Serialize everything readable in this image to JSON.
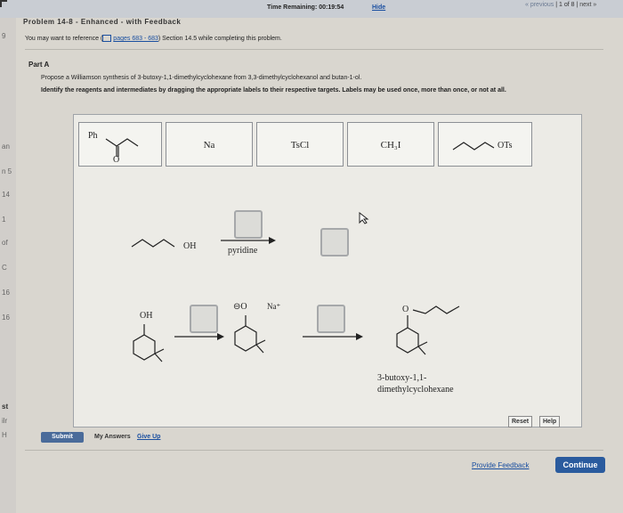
{
  "header": {
    "timer": "Time Remaining:  00:19:54",
    "hide": "Hide",
    "previous": "« previous",
    "page": "1 of 8",
    "next": "next »"
  },
  "problem": {
    "title": "Problem 14-8 - Enhanced - with Feedback",
    "reference_prefix": "You may want to reference (",
    "reference_link": "pages 683 - 683",
    "reference_suffix": ") Section 14.5 while completing this problem."
  },
  "part": {
    "label": "Part A",
    "prompt": "Propose a Williamson synthesis of 3-butoxy-1,1-dimethylcyclohexane from 3,3-dimethylcyclohexanol and butan-1-ol.",
    "instructions": "Identify the reagents and intermediates by dragging the appropriate labels to their respective targets. Labels may be used once, more than once, or not at all."
  },
  "labels": {
    "ph_ketone_ph": "Ph",
    "ph_ketone_o": "O",
    "na": "Na",
    "tscl": "TsCl",
    "ch3i": "CH₃I",
    "ots": "OTs"
  },
  "scheme": {
    "oh_top": "OH",
    "pyridine": "pyridine",
    "oh_left": "OH",
    "o_minus": "⊖O",
    "na_plus": "Na⁺",
    "o_product": "O",
    "product_name_line1": "3-butoxy-1,1-",
    "product_name_line2": "dimethylcyclohexane"
  },
  "controls": {
    "reset": "Reset",
    "help": "Help",
    "submit": "Submit",
    "my_answers": "My Answers",
    "give_up": "Give Up",
    "feedback": "Provide Feedback",
    "continue": "Continue"
  },
  "strip_marks": [
    "9",
    "an",
    "n 5",
    "14",
    "1",
    "of",
    "C",
    "16",
    "16",
    "st",
    "ilr",
    "H"
  ]
}
